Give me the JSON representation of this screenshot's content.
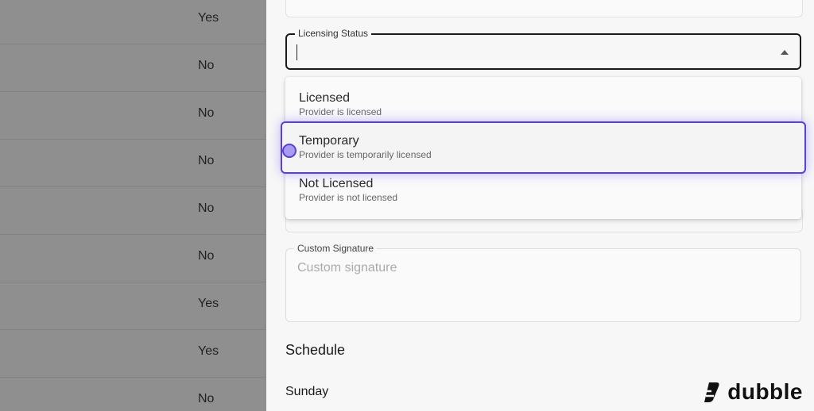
{
  "table": {
    "rows": [
      "Yes",
      "No",
      "No",
      "No",
      "No",
      "No",
      "Yes",
      "Yes",
      "No"
    ]
  },
  "form": {
    "licensing_status": {
      "label": "Licensing Status",
      "value": ""
    },
    "options": [
      {
        "title": "Licensed",
        "subtitle": "Provider is licensed"
      },
      {
        "title": "Temporary",
        "subtitle": "Provider is temporarily licensed"
      },
      {
        "title": "Not Licensed",
        "subtitle": "Provider is not licensed"
      }
    ],
    "custom_signature": {
      "label": "Custom Signature",
      "placeholder": "Custom signature"
    },
    "schedule": {
      "title": "Schedule",
      "first_day": "Sunday"
    }
  },
  "brand": {
    "name": "dubble",
    "accent": "#5b3fd6"
  }
}
